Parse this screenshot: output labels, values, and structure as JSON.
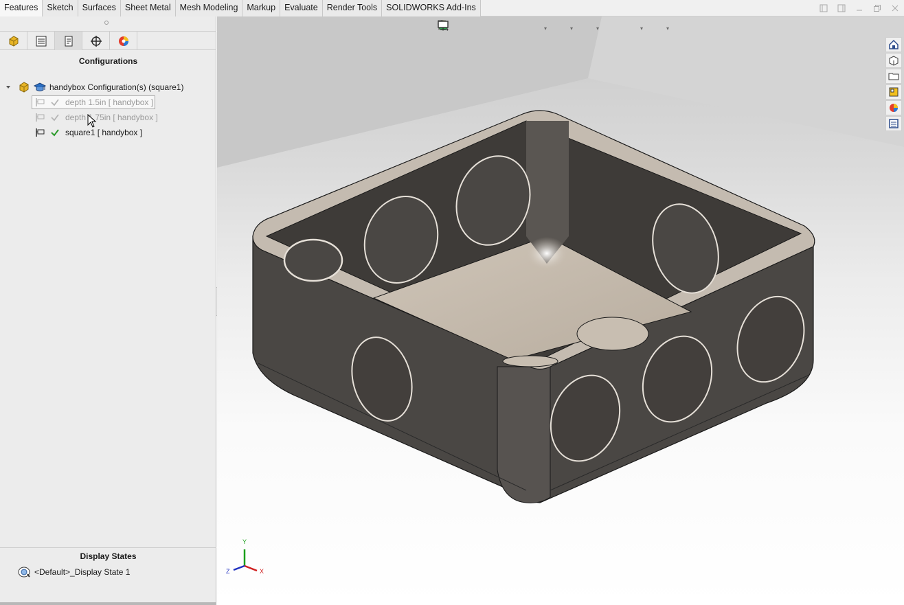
{
  "command_tabs": [
    {
      "label": "Features",
      "active": true
    },
    {
      "label": "Sketch",
      "active": false
    },
    {
      "label": "Surfaces",
      "active": false
    },
    {
      "label": "Sheet Metal",
      "active": false
    },
    {
      "label": "Mesh Modeling",
      "active": false
    },
    {
      "label": "Markup",
      "active": false
    },
    {
      "label": "Evaluate",
      "active": false
    },
    {
      "label": "Render Tools",
      "active": false
    },
    {
      "label": "SOLIDWORKS Add-Ins",
      "active": false
    }
  ],
  "configuration_panel": {
    "title": "Configurations",
    "root": {
      "label": "handybox Configuration(s)  (square1)"
    },
    "items": [
      {
        "label": "depth 1.5in [ handybox ]",
        "active": false
      },
      {
        "label": "depth 1.75in [ handybox ]",
        "active": false
      },
      {
        "label": "square1 [ handybox ]",
        "active": true
      }
    ]
  },
  "display_states": {
    "title": "Display States",
    "items": [
      {
        "label": "<Default>_Display State 1"
      }
    ]
  },
  "triad": {
    "x": "X",
    "y": "Y",
    "z": "Z"
  },
  "colors": {
    "active_check": "#2a9a2a",
    "inactive_check": "#b5b5b5",
    "model_face": "#4a4744",
    "model_light": "#bdb3a6"
  }
}
